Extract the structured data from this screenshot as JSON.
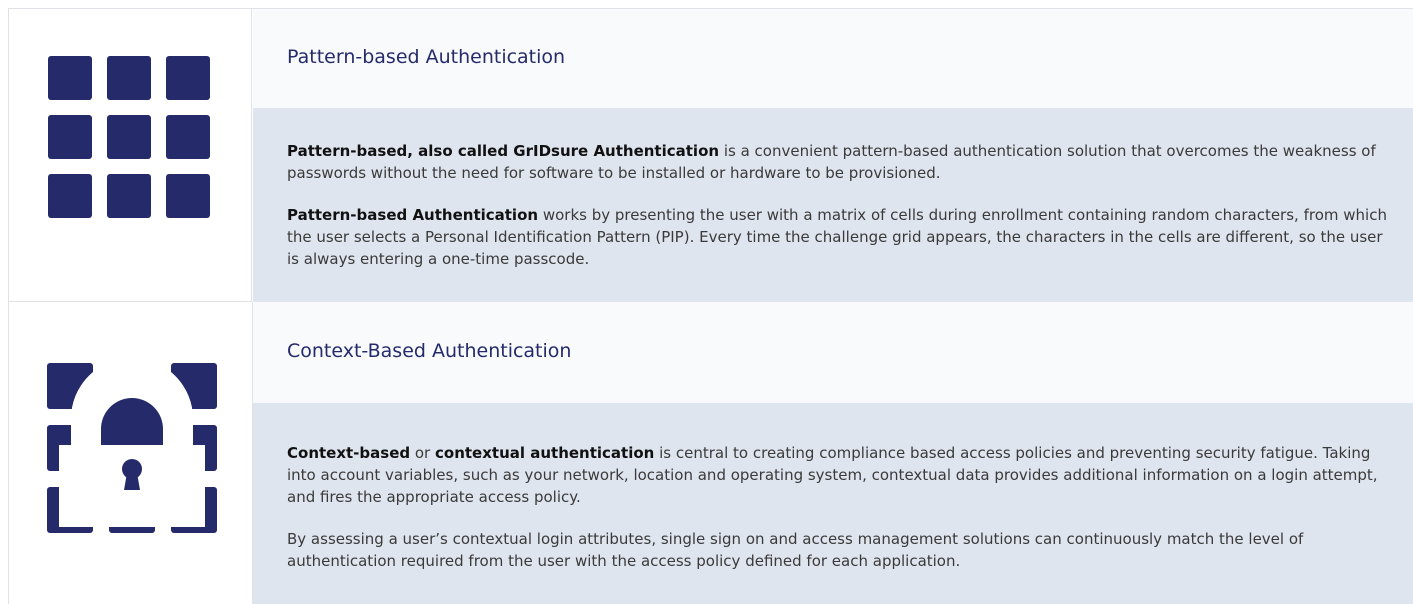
{
  "colors": {
    "navy": "#252a6b",
    "title_band": "#f8fafc",
    "body_band": "#dfe5ee",
    "border": "#dfe3e8"
  },
  "sections": [
    {
      "icon": "grid-icon",
      "title": "Pattern-based Authentication",
      "p1_bold": "Pattern-based, also called GrIDsure Authentication",
      "p1_text": " is a convenient pattern-based authentication solution that overcomes the weakness of passwords without the need for software to be installed or hardware to be provisioned.",
      "p2_bold": "Pattern-based Authentication",
      "p2_text": " works by presenting the user with a matrix of cells during enrollment containing random characters, from which the user selects a Personal Identification Pattern (PIP). Every time the challenge grid appears, the characters in the cells are different, so the user is always entering a one-time passcode."
    },
    {
      "icon": "padlock-grid-icon",
      "title": "Context-Based Authentication",
      "p1_bold_a": "Context-based",
      "p1_mid": " or ",
      "p1_bold_b": "contextual authentication",
      "p1_text": " is central to creating compliance based access policies and preventing security fatigue. Taking into account variables, such as your network, location and operating system, contextual data provides additional information on a login attempt, and fires the appropriate access policy.",
      "p2_text": "By assessing a user’s contextual login attributes, single sign on and access management solutions can continuously match the level of authentication required from the user with the access policy defined for each application."
    }
  ]
}
